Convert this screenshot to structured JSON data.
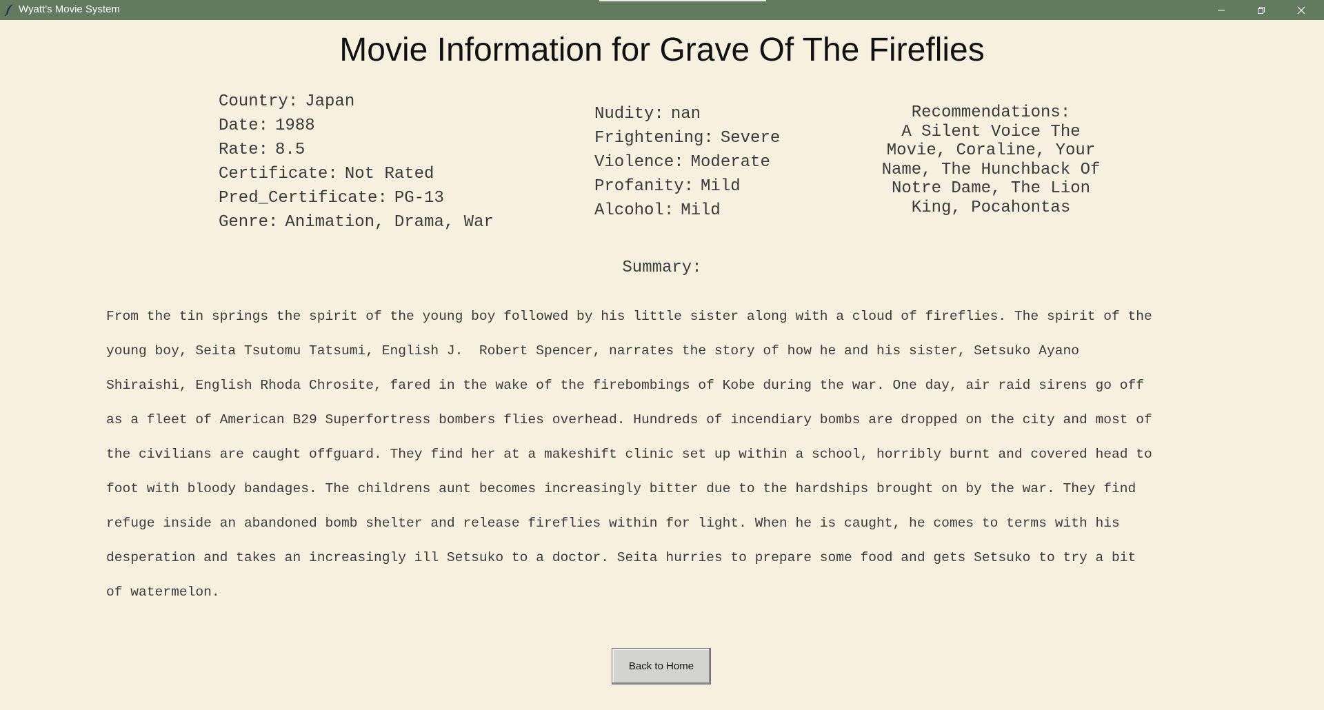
{
  "window": {
    "title": "Wyatt's Movie System",
    "icons": {
      "app": "feather-icon",
      "minimize": "minimize-icon",
      "maximize": "maximize-icon",
      "close": "close-icon"
    },
    "titlebar_color": "#627a5d",
    "background_color": "#f7f0de"
  },
  "page_title": "Movie Information for Grave Of The Fireflies",
  "details": [
    {
      "label": "Country:",
      "value": "Japan"
    },
    {
      "label": "Date:",
      "value": "1988"
    },
    {
      "label": "Rate:",
      "value": "8.5"
    },
    {
      "label": "Certificate:",
      "value": "Not Rated"
    },
    {
      "label": "Pred_Certificate:",
      "value": "PG-13"
    },
    {
      "label": "Genre:",
      "value": "Animation, Drama, War"
    }
  ],
  "content_ratings": [
    {
      "label": "Nudity:",
      "value": "nan"
    },
    {
      "label": "Frightening:",
      "value": "Severe"
    },
    {
      "label": "Violence:",
      "value": "Moderate"
    },
    {
      "label": "Profanity:",
      "value": "Mild"
    },
    {
      "label": "Alcohol:",
      "value": "Mild"
    }
  ],
  "recommendations": {
    "label": "Recommendations:",
    "lines": [
      "A Silent Voice The",
      "Movie, Coraline, Your",
      "Name, The Hunchback Of",
      "Notre Dame, The Lion",
      "King, Pocahontas"
    ]
  },
  "summary": {
    "label": "Summary:",
    "lines": [
      "From the tin springs the spirit of the young boy followed by his little sister along with a cloud of fireflies. The spirit of the",
      "young boy, Seita Tsutomu Tatsumi, English J.  Robert Spencer, narrates the story of how he and his sister, Setsuko Ayano",
      "Shiraishi, English Rhoda Chrosite, fared in the wake of the firebombings of Kobe during the war. One day, air raid sirens go off",
      "as a fleet of American B29 Superfortress bombers flies overhead. Hundreds of incendiary bombs are dropped on the city and most of",
      "the civilians are caught offguard. They find her at a makeshift clinic set up within a school, horribly burnt and covered head to",
      "foot with bloody bandages. The childrens aunt becomes increasingly bitter due to the hardships brought on by the war. They find",
      "refuge inside an abandoned bomb shelter and release fireflies within for light. When he is caught, he comes to terms with his",
      "desperation and takes an increasingly ill Setsuko to a doctor. Seita hurries to prepare some food and gets Setsuko to try a bit",
      "of watermelon."
    ]
  },
  "back_button_label": "Back to Home"
}
